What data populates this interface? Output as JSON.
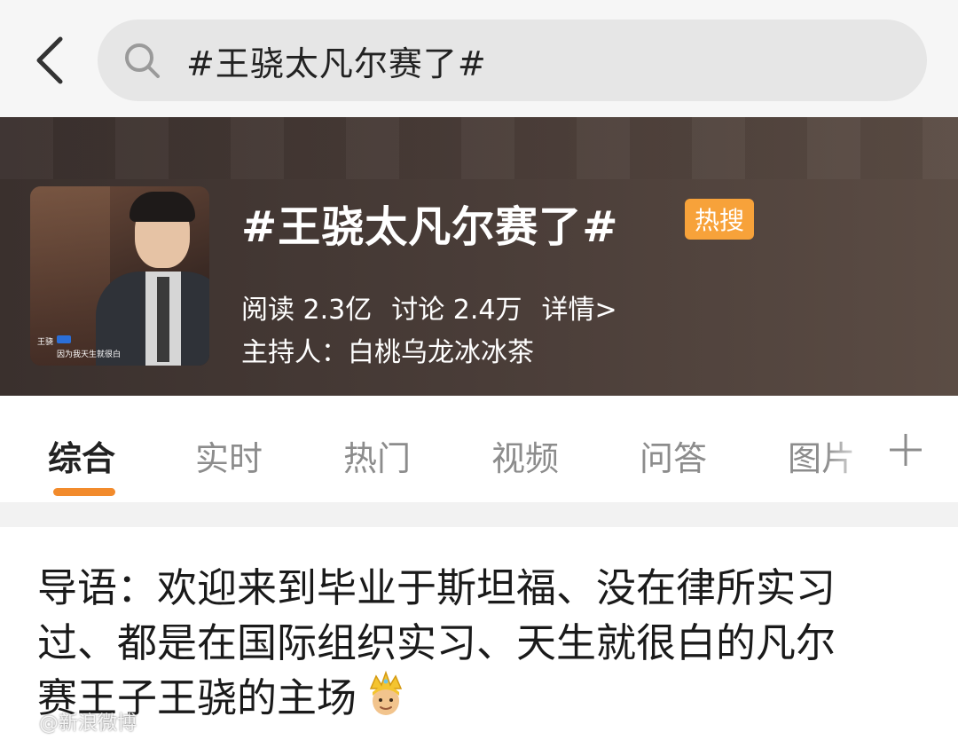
{
  "search": {
    "query": "#王骁太凡尔赛了#",
    "icon": "search-icon"
  },
  "header": {
    "back_icon": "chevron-left-icon"
  },
  "topic": {
    "title": "#王骁太凡尔赛了#",
    "badge": "热搜",
    "badge_color": "#f7a23a",
    "reads": "阅读 2.3亿",
    "discussions": "讨论 2.4万",
    "details_link": "详情>",
    "host": "主持人：白桃乌龙冰冰茶",
    "thumbnail": {
      "caption_name": "王骁",
      "caption_text": "因为我天生就很白"
    }
  },
  "tabs": {
    "items": [
      {
        "label": "综合",
        "active": true
      },
      {
        "label": "实时",
        "active": false
      },
      {
        "label": "热门",
        "active": false
      },
      {
        "label": "视频",
        "active": false
      },
      {
        "label": "问答",
        "active": false
      },
      {
        "label": "图片",
        "active": false
      }
    ],
    "accent_color": "#f28b2c",
    "more_icon": "plus-icon"
  },
  "intro": {
    "line1": "导语：欢迎来到毕业于斯坦福、没在律所实习",
    "line2": "过、都是在国际组织实习、天生就很白的凡尔",
    "line3": "赛王子王骁的主场",
    "emoji": "crown-prince-emoji"
  },
  "watermark": {
    "text": "@新浪微博"
  }
}
